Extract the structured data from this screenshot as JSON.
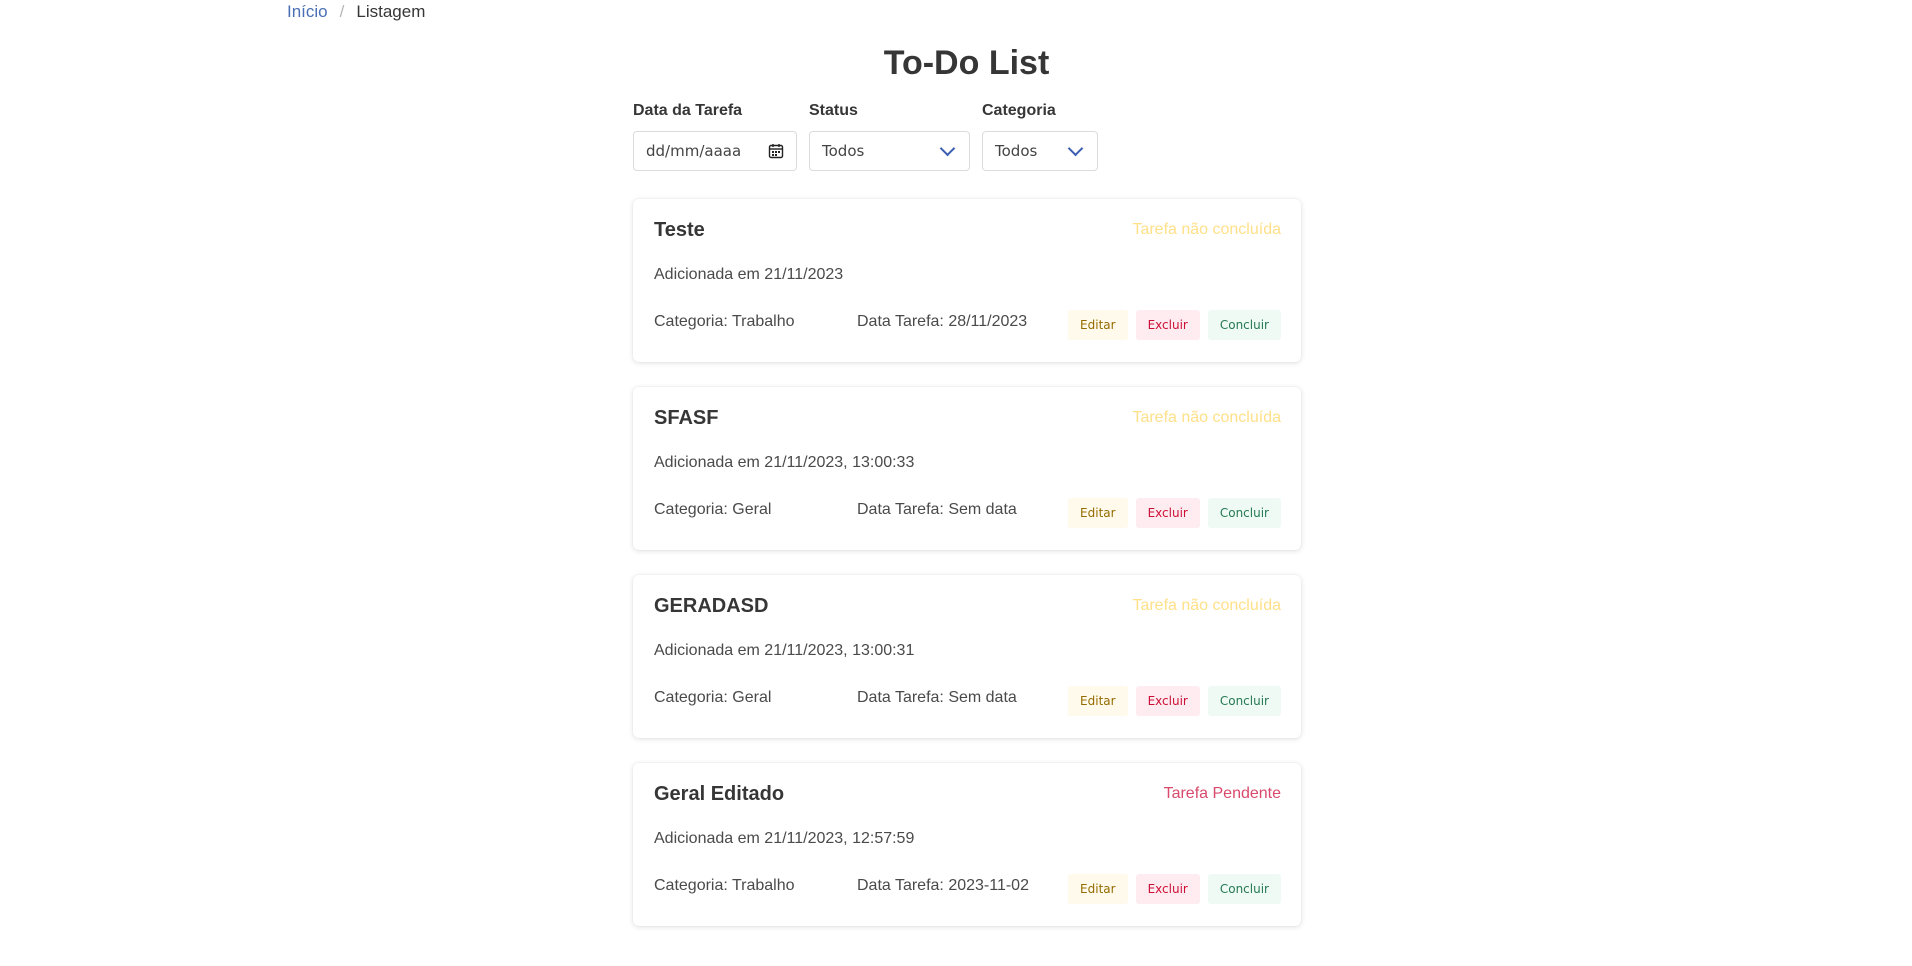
{
  "breadcrumb": {
    "home": "Início",
    "current": "Listagem"
  },
  "page_title": "To-Do List",
  "filters": {
    "date": {
      "label": "Data da Tarefa",
      "placeholder": "dd/mm/aaaa"
    },
    "status": {
      "label": "Status",
      "value": "Todos"
    },
    "category": {
      "label": "Categoria",
      "value": "Todos"
    }
  },
  "buttons": {
    "edit": "Editar",
    "delete": "Excluir",
    "complete": "Concluir"
  },
  "tasks": [
    {
      "title": "Teste",
      "status": "Tarefa não concluída",
      "added": "Adicionada em 21/11/2023",
      "category": "Categoria: Trabalho",
      "task_date": "Data Tarefa: 28/11/2023"
    },
    {
      "title": "SFASF",
      "status": "Tarefa não concluída",
      "added": "Adicionada em 21/11/2023, 13:00:33",
      "category": "Categoria: Geral",
      "task_date": "Data Tarefa: Sem data"
    },
    {
      "title": "GERADASD",
      "status": "Tarefa não concluída",
      "added": "Adicionada em 21/11/2023, 13:00:31",
      "category": "Categoria: Geral",
      "task_date": "Data Tarefa: Sem data"
    },
    {
      "title": "Geral Editado",
      "status": "Tarefa Pendente",
      "added": "Adicionada em 21/11/2023, 12:57:59",
      "category": "Categoria: Trabalho",
      "task_date": "Data Tarefa: 2023-11-02"
    }
  ],
  "colors": {
    "link": "#4a6fb5",
    "status_not_done": "#ffe08a",
    "status_pending": "#d94a6c",
    "edit_bg": "#fffaeb",
    "delete_bg": "#feecf0",
    "complete_bg": "#effaf5"
  },
  "icons": {
    "date": "calendar-icon",
    "select": "chevron-down-icon"
  }
}
